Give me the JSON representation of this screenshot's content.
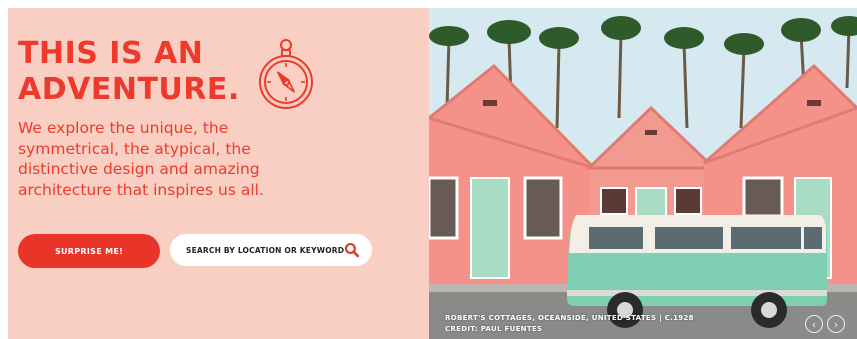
{
  "hero": {
    "headline_line1": "THIS IS AN",
    "headline_line2": "ADVENTURE.",
    "intro_lines": [
      "We explore the unique, the",
      "symmetrical, the atypical, the",
      "distinctive design and amazing",
      "architecture that inspires us all."
    ],
    "surprise_button": "SURPRISE ME!",
    "search_placeholder": "SEARCH BY LOCATION OR KEYWORD"
  },
  "photo": {
    "caption_line1": "ROBERT'S COTTAGES, OCEANSIDE, UNITED STATES | C.1928",
    "caption_line2": "CREDIT: PAUL FUENTES",
    "prev_icon": "chevron-left-icon",
    "next_icon": "chevron-right-icon"
  },
  "colors": {
    "accent_red": "#ee3a2c",
    "panel_pink": "#f9cfc4",
    "cottage_pink": "#f4928a",
    "van_mint": "#7fcfb3"
  }
}
